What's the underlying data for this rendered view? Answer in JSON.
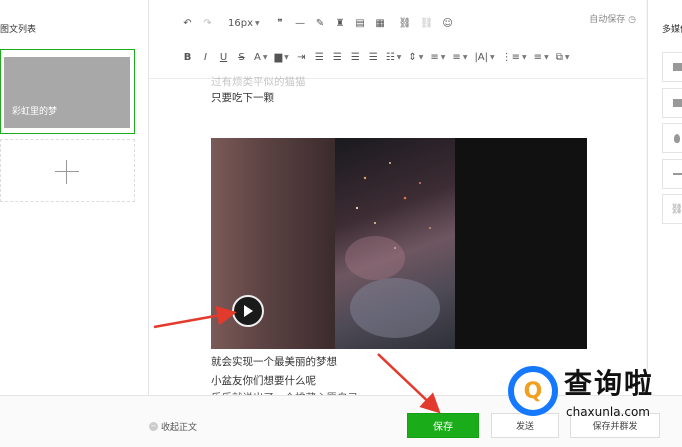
{
  "left_panel": {
    "title": "图文列表",
    "article_title": "彩虹里的梦"
  },
  "toolbar": {
    "font_size": "16px",
    "autosave_label": "自动保存"
  },
  "content": {
    "cut_line": "过有烦类平似的猫猫",
    "line1": "只要吃下一颗",
    "para1": "就会实现一个最美丽的梦想",
    "para2": "小盆友你们想要什么呢",
    "para3": "乐乐就说出了一个排藏心愿自己"
  },
  "right_panel": {
    "title": "多媒体"
  },
  "bottom_bar": {
    "collapse_label": "收起正文",
    "save_label": "保存",
    "send_label": "发送",
    "save_send_label": "保存并群发"
  },
  "watermark": {
    "cn": "查询啦",
    "url": "chaxunla.com"
  },
  "colors": {
    "accent_green": "#1aad19",
    "arrow_red": "#e23b2e",
    "watermark_blue": "#1677ff"
  }
}
